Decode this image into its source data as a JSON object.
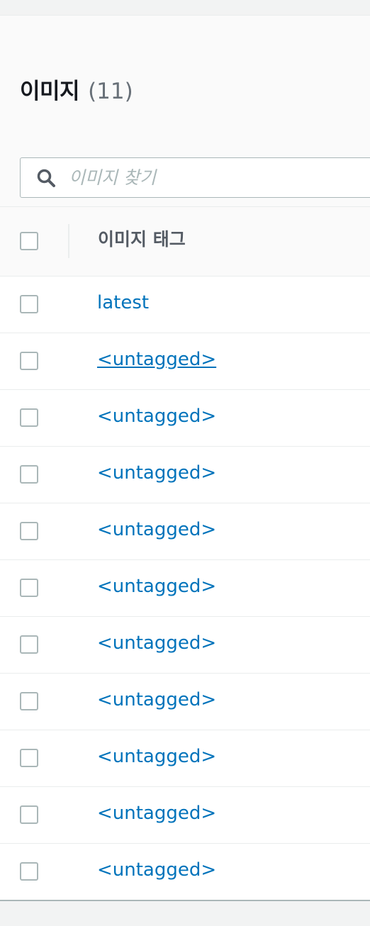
{
  "header": {
    "title": "이미지",
    "count": "(11)"
  },
  "search": {
    "placeholder": "이미지 찾기",
    "value": ""
  },
  "table": {
    "columns": [
      "이미지 태그"
    ],
    "rows": [
      {
        "tag": "latest"
      },
      {
        "tag": "<untagged>"
      },
      {
        "tag": "<untagged>"
      },
      {
        "tag": "<untagged>"
      },
      {
        "tag": "<untagged>"
      },
      {
        "tag": "<untagged>"
      },
      {
        "tag": "<untagged>"
      },
      {
        "tag": "<untagged>"
      },
      {
        "tag": "<untagged>"
      },
      {
        "tag": "<untagged>"
      },
      {
        "tag": "<untagged>"
      }
    ]
  },
  "icons": {
    "search": "search-icon",
    "checkbox": "checkbox-icon"
  },
  "colors": {
    "link": "#0073bb",
    "title": "#16191f",
    "muted": "#687078",
    "border": "#aab7b8",
    "background": "#fafafa"
  }
}
